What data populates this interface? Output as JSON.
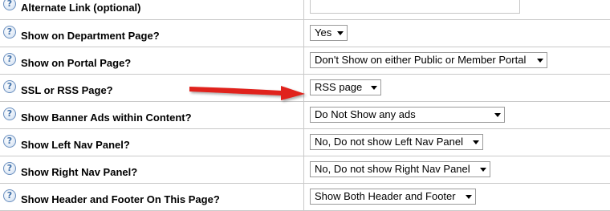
{
  "help_icon_glyph": "?",
  "rows": [
    {
      "label": "Alternate Link (optional)",
      "value": "",
      "control": "text"
    },
    {
      "label": "Show on Department Page?",
      "value": "Yes",
      "control": "select"
    },
    {
      "label": "Show on Portal Page?",
      "value": "Don't Show on either Public or Member Portal",
      "control": "select"
    },
    {
      "label": "SSL or RSS Page?",
      "value": "RSS page",
      "control": "select"
    },
    {
      "label": "Show Banner Ads within Content?",
      "value": "Do Not Show any ads",
      "control": "select"
    },
    {
      "label": "Show Left Nav Panel?",
      "value": "No, Do not show Left Nav Panel",
      "control": "select"
    },
    {
      "label": "Show Right Nav Panel?",
      "value": "No, Do not show Right Nav Panel",
      "control": "select"
    },
    {
      "label": "Show Header and Footer On This Page?",
      "value": "Show Both Header and Footer",
      "control": "select"
    }
  ],
  "annotation": {
    "icon": "red-arrow-icon",
    "color": "#e0201b",
    "points_to": "SSL or RSS Page? select"
  },
  "colors": {
    "grid_line": "#c9c9c9",
    "help_icon_blue": "#3f6fa8"
  }
}
